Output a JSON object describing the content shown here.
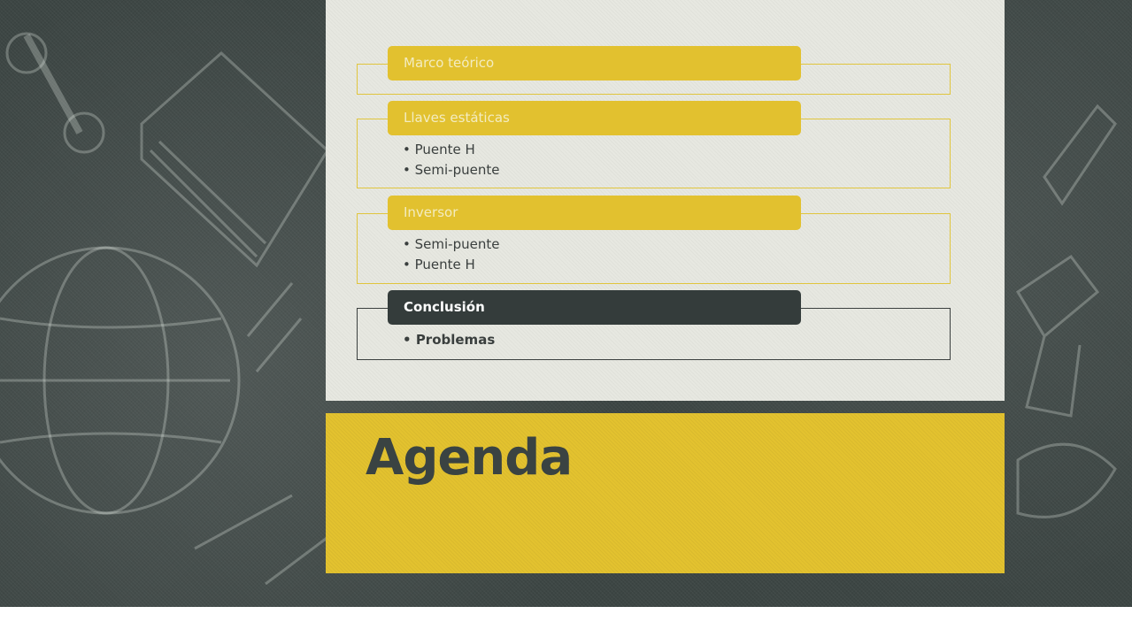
{
  "slide": {
    "title": "Agenda",
    "colors": {
      "background": "#3d4644",
      "card": "#e7e8e1",
      "accent": "#e2c12f",
      "dark": "#343c3b"
    },
    "sections": [
      {
        "label": "Marco teórico",
        "bullets": [],
        "style": "accent"
      },
      {
        "label": "Llaves estáticas",
        "bullets": [
          "Puente H",
          "Semi-puente"
        ],
        "style": "accent"
      },
      {
        "label": "Inversor",
        "bullets": [
          "Semi-puente",
          "Puente H"
        ],
        "style": "accent"
      },
      {
        "label": "Conclusión",
        "bullets": [
          "Problemas"
        ],
        "style": "dark"
      }
    ]
  }
}
